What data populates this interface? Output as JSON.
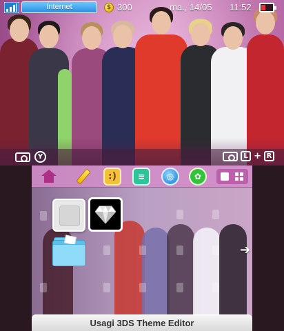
{
  "status_bar": {
    "network_label": "Internet",
    "coins": "300",
    "date": "ma., 14/05",
    "time": "11:52",
    "battery_level": 0.35,
    "battery_color": "#e8333a"
  },
  "top_hints": {
    "left_button": "Y",
    "right_buttons": [
      "L",
      "+",
      "R"
    ]
  },
  "toolbar": {
    "items": [
      "home-icon",
      "pencil-icon",
      "smile-icon",
      "chat-icon",
      "globe-icon",
      "friends-icon"
    ],
    "view_modes": [
      "single-view-icon",
      "grid-view-icon"
    ]
  },
  "apps": [
    {
      "name": "blank-app-icon"
    },
    {
      "name": "diamond-app-icon"
    },
    {
      "name": "folder-icon"
    }
  ],
  "bottom_title": "Usagi 3DS Theme Editor",
  "colors": {
    "accent_pink": "#d28cc8",
    "network_blue": "#2a8fe0"
  }
}
